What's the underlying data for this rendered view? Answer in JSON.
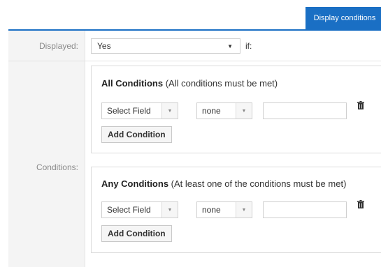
{
  "tabs": {
    "active": "Display conditions"
  },
  "displayed": {
    "label": "Displayed:",
    "value": "Yes",
    "suffix": "if:"
  },
  "conditions": {
    "label": "Conditions:",
    "groups": [
      {
        "title_bold": "All Conditions",
        "title_rest": " (All conditions must be met)",
        "field_select": "Select Field",
        "operator_select": "none",
        "value": "",
        "add_button": "Add Condition"
      },
      {
        "title_bold": "Any Conditions",
        "title_rest": " (At least one of the conditions must be met)",
        "field_select": "Select Field",
        "operator_select": "none",
        "value": "",
        "add_button": "Add Condition"
      }
    ]
  },
  "icons": {
    "trash": "trash-icon",
    "dropdown": "chevron-down-icon"
  }
}
